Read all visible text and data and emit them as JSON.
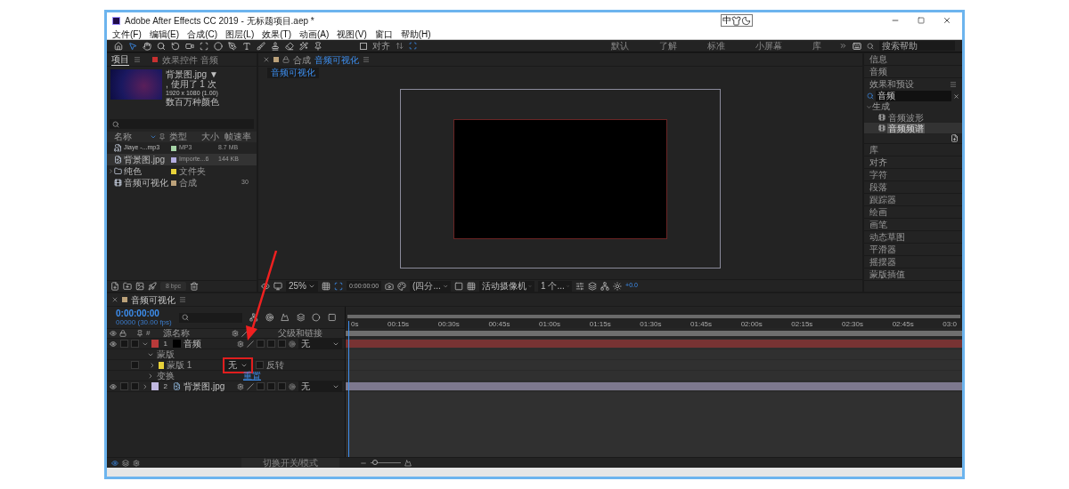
{
  "window": {
    "title": "Adobe After Effects CC 2019 - 无标题项目.aep *",
    "ime": "中"
  },
  "menu": [
    "文件(F)",
    "编辑(E)",
    "合成(C)",
    "图层(L)",
    "效果(T)",
    "动画(A)",
    "视图(V)",
    "窗口",
    "帮助(H)"
  ],
  "toolbar": {
    "snap": {
      "label": "对齐",
      "checked": false
    },
    "workspaces": [
      "默认",
      "了解",
      "标准",
      "小屏幕",
      "库"
    ],
    "search": {
      "placeholder": "搜索帮助"
    }
  },
  "project": {
    "tabs": [
      {
        "label": "项目",
        "selected": true
      },
      {
        "label": "效果控件 音频",
        "selected": false
      }
    ],
    "preview": {
      "name": "背景图.jpg ▼",
      "usage": ", 使用了 1 次",
      "dimensions": "1920 x 1080 (1.00)",
      "colors": "数百万种颜色"
    },
    "columns": [
      "名称",
      "类型",
      "大小",
      "帧速率"
    ],
    "items": [
      {
        "kind": "audio",
        "name": "Jiaye -...mp3",
        "color": "#a6d4a6",
        "type": "MP3",
        "size": "8.7 MB",
        "selected": false
      },
      {
        "kind": "image",
        "name": "背景图.jpg",
        "color": "#b4aee0",
        "type": "Importe...6",
        "size": "144 KB",
        "selected": true
      },
      {
        "kind": "folder",
        "name": "纯色",
        "color": "#e8d23a",
        "type": "文件夹",
        "expanded": false,
        "selected": false
      },
      {
        "kind": "comp",
        "name": "音频可视化",
        "color": "#bca27a",
        "type": "合成",
        "fps": "30",
        "selected": false
      }
    ],
    "bpc": "8 bpc"
  },
  "viewer": {
    "tab": "合成",
    "comp": "音频可视化",
    "breadcrumb": "音频可视化",
    "zoom": "25%",
    "time": "0:00:00:00",
    "resolution": "(四分...",
    "camera": "活动摄像机",
    "views": "1 个...",
    "exposure": "+0.0"
  },
  "panels_top": [
    "信息",
    "音频"
  ],
  "effects": {
    "title": "效果和预设",
    "search": "音频",
    "groups": [
      {
        "label": "生成",
        "expanded": true,
        "children": [
          {
            "label": "音频波形",
            "selected": false
          },
          {
            "label": "音频频谱",
            "selected": true
          }
        ]
      }
    ]
  },
  "panels_bottom": [
    "库",
    "对齐",
    "字符",
    "段落",
    "跟踪器",
    "绘画",
    "画笔",
    "动态草图",
    "平滑器",
    "摇摆器",
    "蒙版插值"
  ],
  "timeline": {
    "tab": "音频可视化",
    "time": "0:00:00:00",
    "fps": "00000 (30.00 fps)",
    "number_header": "#",
    "name_header": "源名称",
    "parent_header": "父级和链接",
    "layers": [
      {
        "number": "1",
        "kind": "solid",
        "name": "音频",
        "color": "#b83a3a",
        "visible": true,
        "expanded": true,
        "parent": "无",
        "children": [
          {
            "kind": "group",
            "label": "蒙版",
            "expanded": true,
            "children": [
              {
                "kind": "mask",
                "label": "蒙版 1",
                "color": "#e8d23a",
                "expanded": false,
                "mode": "无",
                "highlighted": true,
                "invert": "反转"
              }
            ]
          },
          {
            "kind": "group",
            "label": "变换",
            "expanded": false,
            "action": "重置"
          }
        ]
      },
      {
        "number": "2",
        "kind": "image",
        "name": "背景图.jpg",
        "color": "#c0b8e0",
        "visible": true,
        "expanded": false,
        "parent": "无"
      }
    ],
    "ruler": [
      "0s",
      "00:15s",
      "00:30s",
      "00:45s",
      "01:00s",
      "01:15s",
      "01:30s",
      "01:45s",
      "02:00s",
      "02:15s",
      "02:30s",
      "02:45s",
      "03:0"
    ],
    "toggle": "切换开关/模式",
    "zoom": {
      "level": 0.15
    }
  }
}
